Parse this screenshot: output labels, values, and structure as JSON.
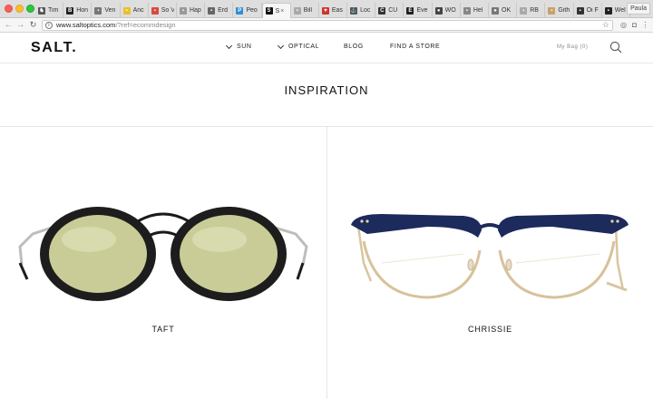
{
  "browser": {
    "tabs": [
      {
        "title": "Tim",
        "icon": "horse-icon",
        "color": "#555555",
        "glyph": "♞"
      },
      {
        "title": "Hon",
        "icon": "b-logo-icon",
        "color": "#222222",
        "glyph": "B"
      },
      {
        "title": "Ven",
        "icon": "ven-icon",
        "color": "#777777",
        "glyph": "▪"
      },
      {
        "title": "Anc",
        "icon": "anc-icon",
        "color": "#e8c22d",
        "glyph": "▪"
      },
      {
        "title": "So V",
        "icon": "so-icon",
        "color": "#d94a3c",
        "glyph": "▪"
      },
      {
        "title": "Hap",
        "icon": "hap-icon",
        "color": "#999999",
        "glyph": "▪"
      },
      {
        "title": "Erd",
        "icon": "erd-icon",
        "color": "#666666",
        "glyph": "▪"
      },
      {
        "title": "Peo",
        "icon": "p-logo-icon",
        "color": "#2e8fd6",
        "glyph": "P"
      },
      {
        "title": "S",
        "icon": "salt-s-icon",
        "color": "#111111",
        "glyph": "S",
        "active": true
      },
      {
        "title": "Bill",
        "icon": "bill-icon",
        "color": "#aaaaaa",
        "glyph": "▪"
      },
      {
        "title": "Eas",
        "icon": "heart-icon",
        "color": "#d0342c",
        "glyph": "♥"
      },
      {
        "title": "Loc",
        "icon": "anchor-icon",
        "color": "#555555",
        "glyph": "⚓"
      },
      {
        "title": "CU",
        "icon": "c-logo-icon",
        "color": "#333333",
        "glyph": "C"
      },
      {
        "title": "Eve",
        "icon": "e-logo-icon",
        "color": "#222222",
        "glyph": "E"
      },
      {
        "title": "WO",
        "icon": "wo-icon",
        "color": "#444444",
        "glyph": "●"
      },
      {
        "title": "Hel",
        "icon": "hel-icon",
        "color": "#888888",
        "glyph": "▪"
      },
      {
        "title": "OK",
        "icon": "ok-icon",
        "color": "#777777",
        "glyph": "●"
      },
      {
        "title": "RB",
        "icon": "rb-icon",
        "color": "#aaaaaa",
        "glyph": "▪"
      },
      {
        "title": "Gith",
        "icon": "github-icon",
        "color": "#c9a06a",
        "glyph": "▪"
      },
      {
        "title": "Oi F",
        "icon": "oi-icon",
        "color": "#333333",
        "glyph": "▪"
      },
      {
        "title": "Wel",
        "icon": "wel-icon",
        "color": "#222222",
        "glyph": "▪"
      }
    ],
    "profile": "Paula",
    "url_host": "www.saltoptics.com",
    "url_rest": "/?ref=ecommdesign"
  },
  "site": {
    "logo": "SALT.",
    "nav": [
      {
        "label": "SUN",
        "has_dropdown": true
      },
      {
        "label": "OPTICAL",
        "has_dropdown": true
      },
      {
        "label": "BLOG",
        "has_dropdown": false
      },
      {
        "label": "FIND A STORE",
        "has_dropdown": false
      }
    ],
    "bag": "My Bag (0)"
  },
  "heading": "INSPIRATION",
  "products": [
    {
      "name": "TAFT",
      "frame_color": "#1d1d1d",
      "lens_color": "#c9cc96",
      "bridge_color": "#1a1a1a",
      "temple_color": "#b8b8b8"
    },
    {
      "name": "CHRISSIE",
      "frame_color": "#1c2a5c",
      "rim_color": "#d7c29b",
      "temple_color": "#d9c6a0"
    }
  ],
  "colors": {
    "accent": "#111111",
    "divider": "#e6e6e6"
  }
}
